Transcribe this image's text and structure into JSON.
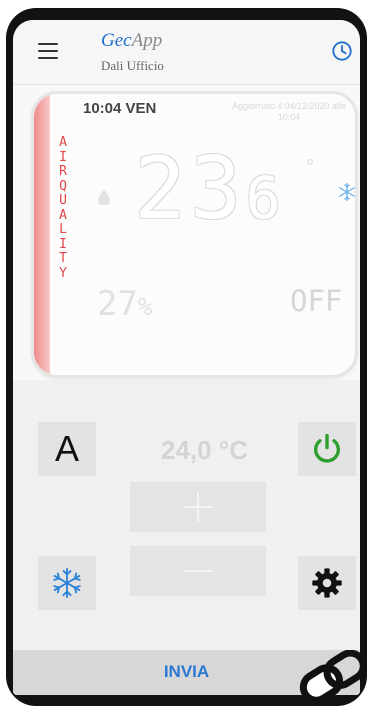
{
  "header": {
    "title_part1": "Gec",
    "title_part2": "App",
    "subtitle": "Dali Ufficio"
  },
  "panel": {
    "time_day": "10:04 VEN",
    "updated": "Aggiornato il 04/12/2020 alle 10:04",
    "side_label": "AIR QUALITY",
    "temperature": "23",
    "temperature_decimal": "6",
    "humidity_value": "27",
    "humidity_unit": "%",
    "mode": "OFF"
  },
  "controls": {
    "auto_label": "A",
    "setpoint": "24,0 °C",
    "send_label": "INVIA"
  },
  "colors": {
    "accent": "#1f6fc9",
    "power_on": "#2e9e2e",
    "air_quality": "#e2484a",
    "snow": "#2a82d8"
  }
}
